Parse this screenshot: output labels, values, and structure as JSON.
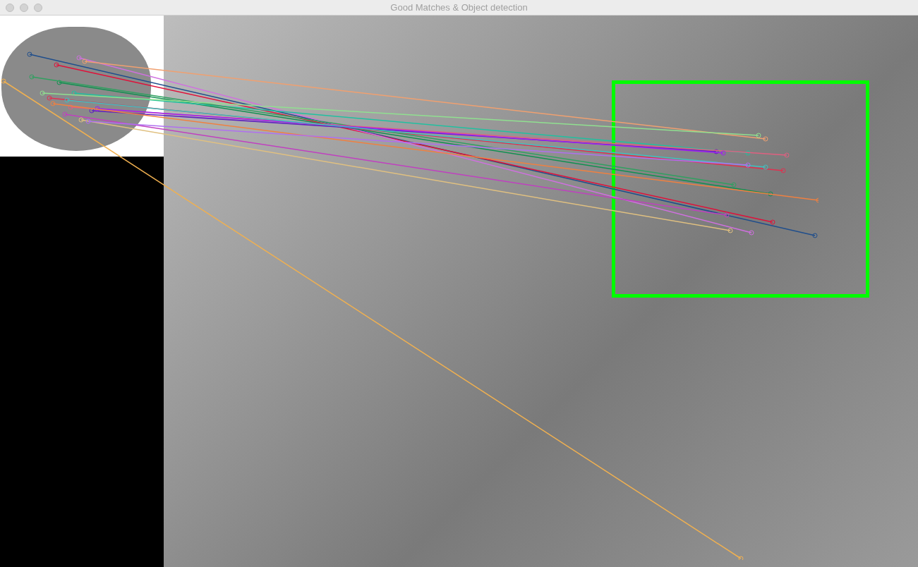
{
  "window": {
    "title": "Good Matches & Object detection"
  }
}
